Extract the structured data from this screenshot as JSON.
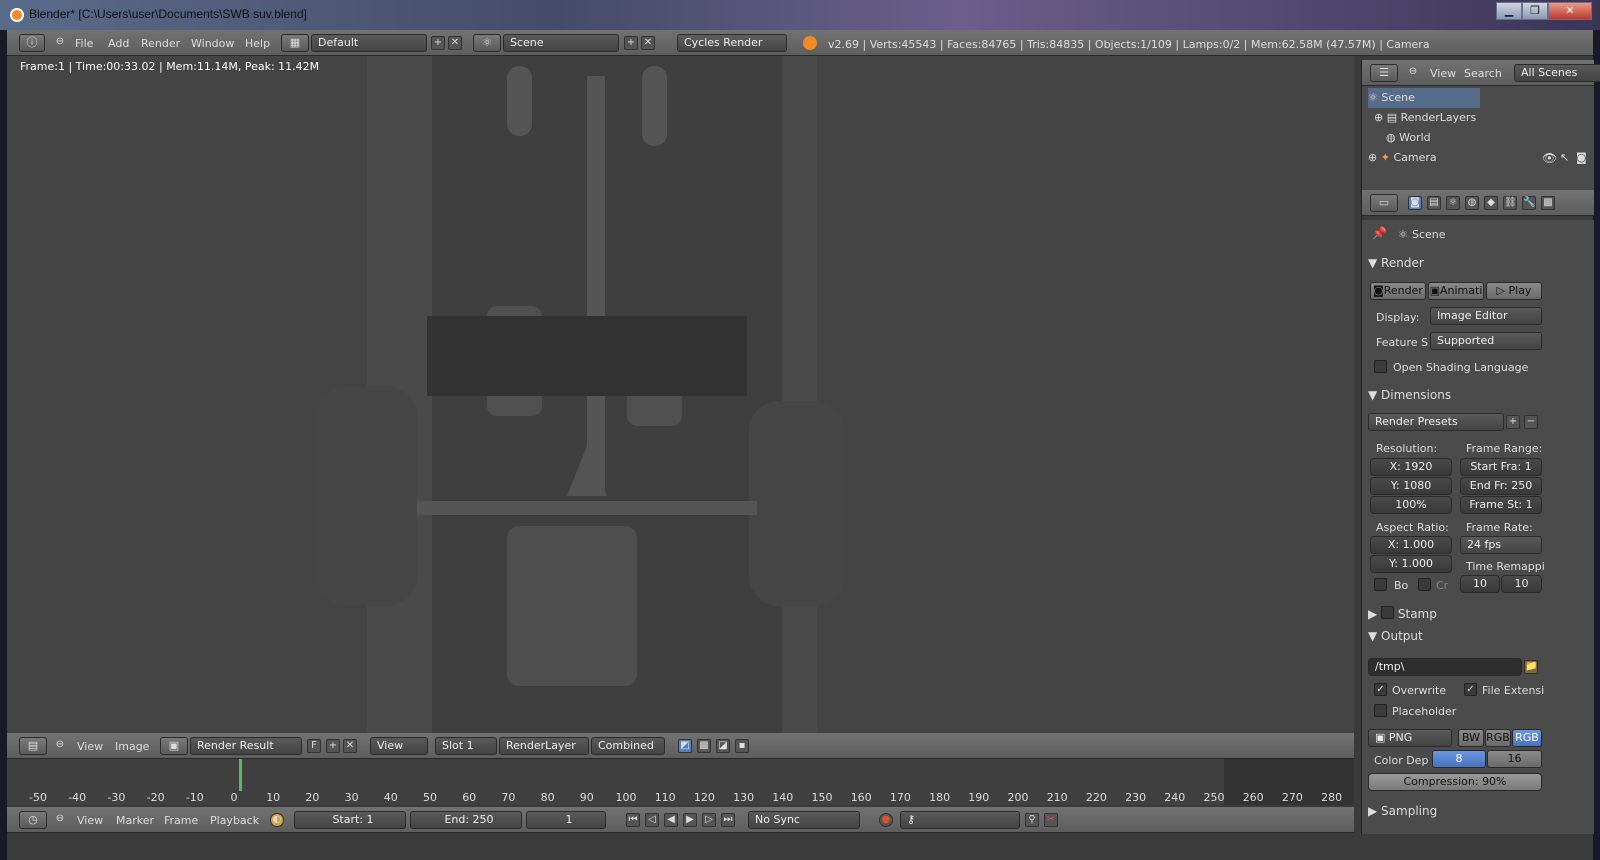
{
  "window": {
    "title": "Blender* [C:\\Users\\user\\Documents\\SWB suv.blend]",
    "btn_min": "▁",
    "btn_max": "❐",
    "btn_close": "✕"
  },
  "info_header": {
    "menus": [
      "File",
      "Add",
      "Render",
      "Window",
      "Help"
    ],
    "screen_layout": "Default",
    "scene": "Scene",
    "engine": "Cycles Render",
    "stats": "v2.69 | Verts:45543 | Faces:84765 | Tris:84835 | Objects:1/109 | Lamps:0/2 | Mem:62.58M (47.57M) | Camera"
  },
  "viewport": {
    "frame_info": "Frame:1 | Time:00:33.02 | Mem:11.14M, Peak: 11.42M"
  },
  "image_editor_header": {
    "menus": [
      "View",
      "Image"
    ],
    "image_name": "Render Result",
    "f_label": "F",
    "view_label": "View",
    "slot": "Slot 1",
    "layer": "RenderLayer",
    "pass": "Combined"
  },
  "timeline": {
    "ticks": [
      "-50",
      "-40",
      "-30",
      "-20",
      "-10",
      "0",
      "10",
      "20",
      "30",
      "40",
      "50",
      "60",
      "70",
      "80",
      "90",
      "100",
      "110",
      "120",
      "130",
      "140",
      "150",
      "160",
      "170",
      "180",
      "190",
      "200",
      "210",
      "220",
      "230",
      "240",
      "250",
      "260",
      "270",
      "280"
    ],
    "current_frame_marker": 0
  },
  "timeline_header": {
    "menus": [
      "View",
      "Marker",
      "Frame",
      "Playback"
    ],
    "start": "Start: 1",
    "end": "End: 250",
    "current": "1",
    "sync": "No Sync"
  },
  "outliner": {
    "menus": [
      "View",
      "Search"
    ],
    "filter": "All Scenes",
    "items": [
      "Scene",
      "RenderLayers",
      "World",
      "Camera"
    ]
  },
  "properties": {
    "context": "Scene",
    "render_section": "Render",
    "render_btn": "Render",
    "anim_btn": "Animati",
    "play_btn": "Play",
    "display_label": "Display:",
    "display_value": "Image Editor",
    "feature_label": "Feature S",
    "feature_value": "Supported",
    "osl_label": "Open Shading Language",
    "dimensions_section": "Dimensions",
    "presets": "Render Presets",
    "resolution_label": "Resolution:",
    "res_x": "X: 1920",
    "res_y": "Y: 1080",
    "res_pct": "100%",
    "frame_range_label": "Frame Range:",
    "start_fra": "Start Fra: 1",
    "end_fra": "End Fr: 250",
    "frame_step": "Frame St: 1",
    "aspect_label": "Aspect Ratio:",
    "aspect_x": "X: 1.000",
    "aspect_y": "Y: 1.000",
    "frame_rate_label": "Frame Rate:",
    "frame_rate": "24 fps",
    "time_remap_label": "Time Remappi",
    "remap_old": "10",
    "remap_new": "10",
    "border_label": "Bo",
    "crop_label": "Cr",
    "stamp_section": "Stamp",
    "output_section": "Output",
    "output_path": "/tmp\\",
    "overwrite": "Overwrite",
    "file_ext": "File Extensi",
    "placeholder": "Placeholder",
    "format": "PNG",
    "bw": "BW",
    "rgb": "RGB",
    "rgba": "RGB",
    "color_depth_label": "Color Dep",
    "depth_8": "8",
    "depth_16": "16",
    "compression": "Compression: 90%",
    "sampling_section": "Sampling"
  }
}
